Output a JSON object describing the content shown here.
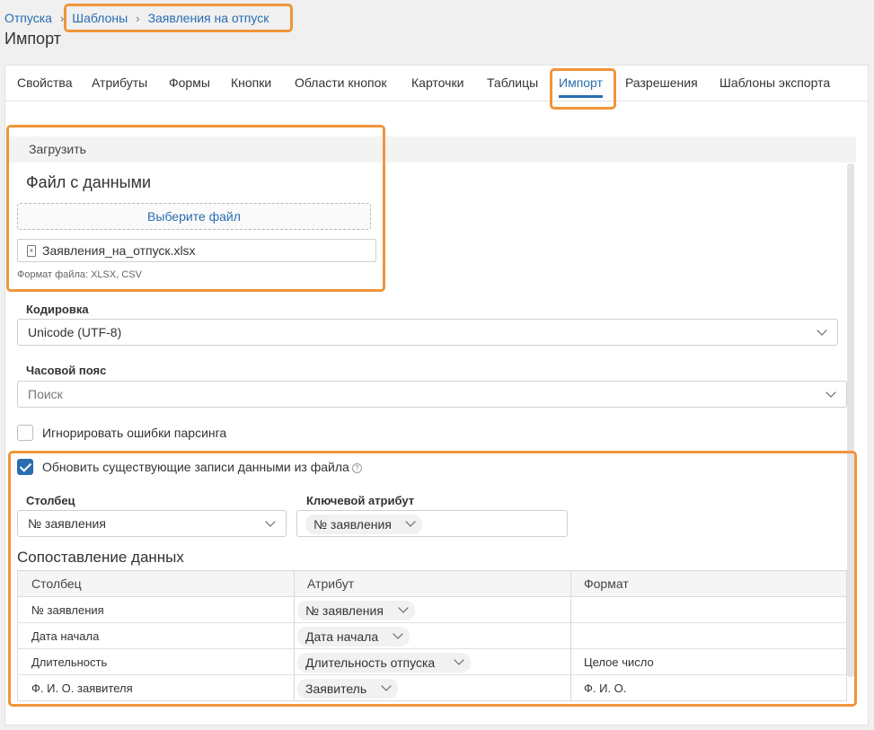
{
  "breadcrumb": [
    "Отпуска",
    "Шаблоны",
    "Заявления на отпуск"
  ],
  "page_title": "Импорт",
  "tabs": [
    "Свойства",
    "Атрибуты",
    "Формы",
    "Кнопки",
    "Области кнопок",
    "Карточки",
    "Таблицы",
    "Импорт",
    "Разрешения",
    "Шаблоны экспорта"
  ],
  "active_tab": "Импорт",
  "upload": {
    "section_label": "Загрузить",
    "file_title": "Файл с данными",
    "choose_button": "Выберите файл",
    "file_name": "Заявления_на_отпуск.xlsx",
    "file_icon_glyph": "x",
    "format_hint": "Формат файла: XLSX, CSV"
  },
  "encoding": {
    "label": "Кодировка",
    "value": "Unicode (UTF-8)"
  },
  "timezone": {
    "label": "Часовой пояс",
    "placeholder": "Поиск"
  },
  "ignore_errors": {
    "label": "Игнорировать ошибки парсинга",
    "checked": false
  },
  "update_existing": {
    "label": "Обновить существующие записи данными из файла",
    "checked": true,
    "help_glyph": "?"
  },
  "column_field": {
    "label": "Столбец",
    "value": "№ заявления"
  },
  "key_attribute": {
    "label": "Ключевой атрибут",
    "value": "№ заявления"
  },
  "mapping": {
    "title": "Сопоставление данных",
    "headers": [
      "Столбец",
      "Атрибут",
      "Формат"
    ],
    "rows": [
      {
        "column": "№ заявления",
        "attribute": "№ заявления",
        "format": ""
      },
      {
        "column": "Дата начала",
        "attribute": "Дата начала",
        "format": ""
      },
      {
        "column": "Длительность",
        "attribute": "Длительность отпуска",
        "format": "Целое число"
      },
      {
        "column": "Ф. И. О. заявителя",
        "attribute": "Заявитель",
        "format": "Ф. И. О."
      }
    ]
  },
  "colors": {
    "accent": "#2a6db0",
    "highlight": "#f0953a"
  }
}
